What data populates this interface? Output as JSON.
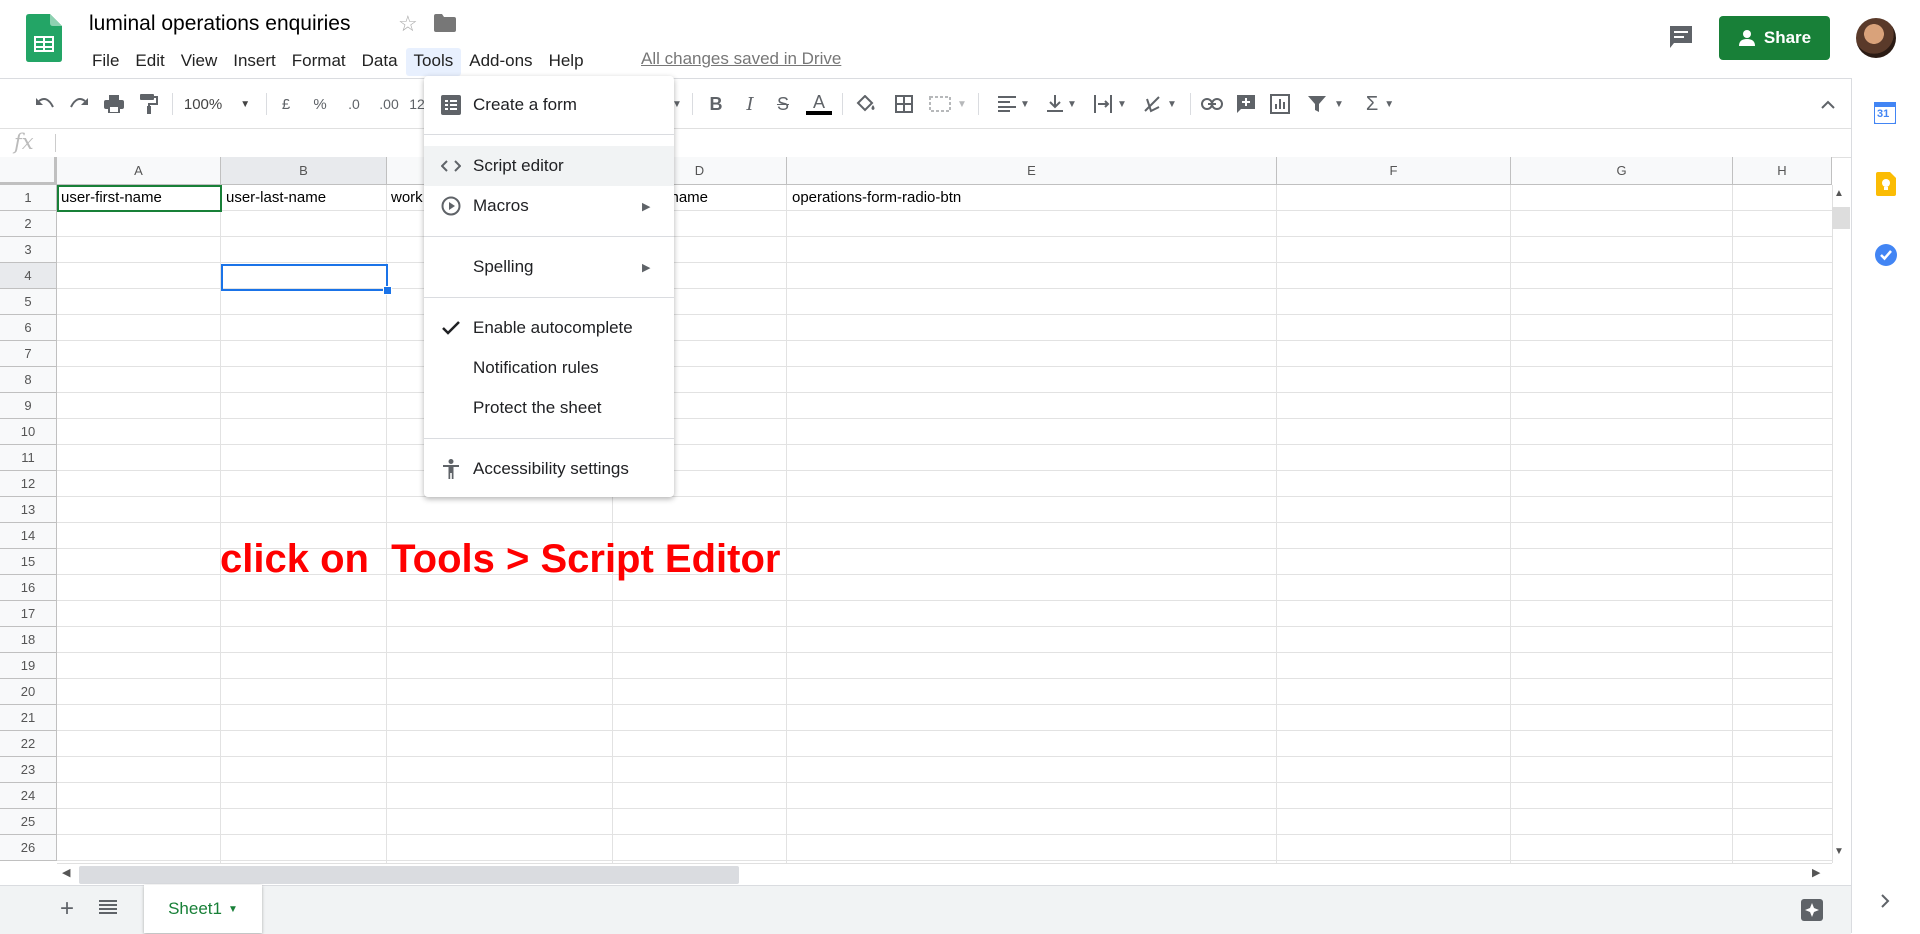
{
  "app": {
    "doc_title": "luminal operations enquiries",
    "save_status": "All changes saved in Drive",
    "share_label": "Share"
  },
  "menubar": [
    "File",
    "Edit",
    "View",
    "Insert",
    "Format",
    "Data",
    "Tools",
    "Add-ons",
    "Help"
  ],
  "toolbar": {
    "zoom": "100%",
    "currency": "£",
    "percent": "%",
    "dec_decrease": ".0",
    "dec_increase": ".00",
    "more_formats": "12"
  },
  "formula_bar": {
    "fx_label": "fx",
    "value": ""
  },
  "columns": [
    "A",
    "B",
    "C",
    "D",
    "E",
    "F",
    "G",
    "H"
  ],
  "rows": [
    "1",
    "2",
    "3",
    "4",
    "5",
    "6",
    "7",
    "8",
    "9",
    "10",
    "11",
    "12",
    "13",
    "14",
    "15",
    "16",
    "17",
    "18",
    "19",
    "20",
    "21",
    "22",
    "23",
    "24",
    "25",
    "26"
  ],
  "cells": {
    "A1": "user-first-name",
    "B1": "user-last-name",
    "C1": "work",
    "D1": "y-name",
    "E1": "operations-form-radio-btn"
  },
  "annotation": "click on  Tools > Script Editor",
  "tools_menu": {
    "items": [
      {
        "label": "Create a form",
        "icon": "form-icon"
      },
      {
        "label": "Script editor",
        "icon": "code-icon"
      },
      {
        "label": "Macros",
        "icon": "play-circle-icon",
        "submenu": true
      },
      {
        "label": "Spelling",
        "submenu": true
      },
      {
        "label": "Enable autocomplete",
        "icon": "check-icon"
      },
      {
        "label": "Notification rules"
      },
      {
        "label": "Protect the sheet"
      },
      {
        "label": "Accessibility settings",
        "icon": "accessibility-icon"
      }
    ],
    "highlighted": "Script editor"
  },
  "sheets": {
    "active": "Sheet1"
  },
  "side_panel": {
    "calendar_day": "31",
    "icons": [
      "calendar-icon",
      "keep-icon",
      "tasks-icon"
    ]
  },
  "colors": {
    "sheets_green": "#188038",
    "selection_blue": "#1a73e8",
    "annotation_red": "#ff0000",
    "menu_highlight": "#f1f3f4"
  }
}
